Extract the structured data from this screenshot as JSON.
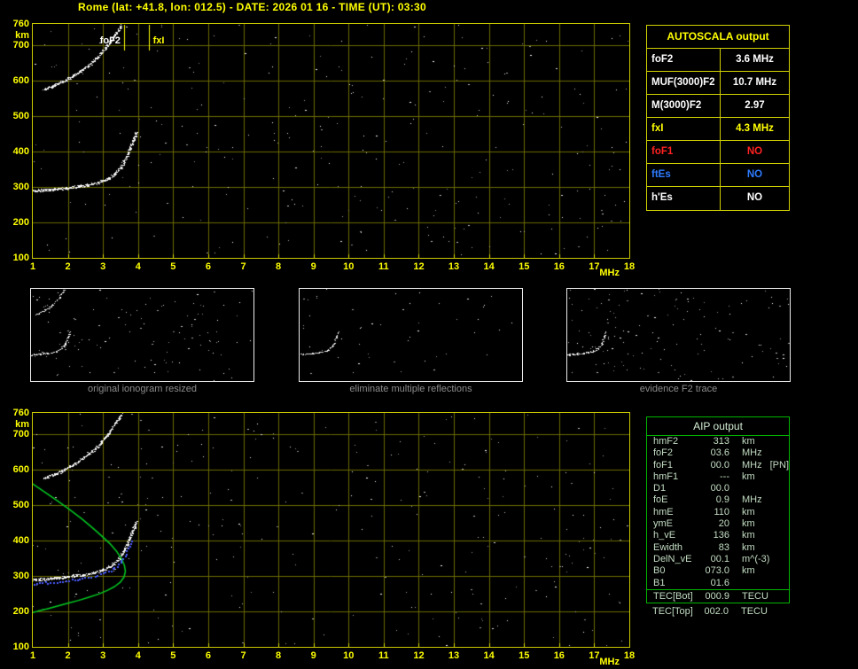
{
  "title": "Rome (lat: +41.8, lon: 012.5) - DATE: 2026 01 16 - TIME (UT): 03:30",
  "top_plot": {
    "y_unit": "km",
    "x_unit": "MHz",
    "y_ticks": [
      "760",
      "700",
      "600",
      "500",
      "400",
      "300",
      "200",
      "100"
    ],
    "x_ticks": [
      "1",
      "2",
      "3",
      "4",
      "5",
      "6",
      "7",
      "8",
      "9",
      "10",
      "11",
      "12",
      "13",
      "14",
      "15",
      "16",
      "17",
      "18"
    ],
    "markers": [
      {
        "label": "foF2",
        "freq_mhz": 3.6
      },
      {
        "label": "fxI",
        "freq_mhz": 4.3
      }
    ]
  },
  "bottom_plot": {
    "y_unit": "km",
    "x_unit": "MHz",
    "y_ticks": [
      "760",
      "700",
      "600",
      "500",
      "400",
      "300",
      "200",
      "100"
    ],
    "x_ticks": [
      "1",
      "2",
      "3",
      "4",
      "5",
      "6",
      "7",
      "8",
      "9",
      "10",
      "11",
      "12",
      "13",
      "14",
      "15",
      "16",
      "17",
      "18"
    ]
  },
  "autoscala_table": {
    "header": "AUTOSCALA output",
    "rows": [
      {
        "label": "foF2",
        "value": "3.6 MHz",
        "color": "white"
      },
      {
        "label": "MUF(3000)F2",
        "value": "10.7 MHz",
        "color": "white"
      },
      {
        "label": "M(3000)F2",
        "value": "2.97",
        "color": "white"
      },
      {
        "label": "fxI",
        "value": "4.3 MHz",
        "color": "yellow"
      },
      {
        "label": "foF1",
        "value": "NO",
        "color": "red"
      },
      {
        "label": "ftEs",
        "value": "NO",
        "color": "blue"
      },
      {
        "label": "h'Es",
        "value": "NO",
        "color": "white"
      }
    ]
  },
  "thumbnails": [
    {
      "caption": "original ionogram resized"
    },
    {
      "caption": "eliminate multiple reflections"
    },
    {
      "caption": "evidence F2 trace"
    }
  ],
  "aip_table": {
    "header": "AIP output",
    "rows": [
      {
        "label": "hmF2",
        "value": "313",
        "unit": "km"
      },
      {
        "label": "foF2",
        "value": "03.6",
        "unit": "MHz"
      },
      {
        "label": "foF1",
        "value": "00.0",
        "unit": "MHz",
        "extra": "[PN]"
      },
      {
        "label": "hmF1",
        "value": "---",
        "unit": "km"
      },
      {
        "label": "D1",
        "value": "00.0",
        "unit": ""
      },
      {
        "label": "foE",
        "value": "0.9",
        "unit": "MHz"
      },
      {
        "label": "hmE",
        "value": "110",
        "unit": "km"
      },
      {
        "label": "ymE",
        "value": "20",
        "unit": "km"
      },
      {
        "label": "h_vE",
        "value": "136",
        "unit": "km"
      },
      {
        "label": "Ewidth",
        "value": "83",
        "unit": "km"
      },
      {
        "label": "DelN_vE",
        "value": "00.1",
        "unit": "m^(-3)"
      },
      {
        "label": "B0",
        "value": "073.0",
        "unit": "km"
      },
      {
        "label": "B1",
        "value": "01.6",
        "unit": ""
      },
      {
        "label": "TEC[Bot]",
        "value": "000.9",
        "unit": "TECU",
        "section": "tecbot"
      },
      {
        "label": "TEC[Top]",
        "value": "002.0",
        "unit": "TECU",
        "section": "below"
      }
    ]
  },
  "colors": {
    "accent_yellow": "#ffff00",
    "plot_border_yellow": "#c9c900",
    "grid_olive": "#6b6b00",
    "table_border_yellow": "#d2d200",
    "aip_border_green": "#00b400",
    "profile_green": "#00cc22",
    "restored_blue": "#4a5cff",
    "status_red": "#ff2222",
    "status_blue": "#2e7bff",
    "caption_gray": "#8c8c8c"
  },
  "chart_data": {
    "type": "scatter",
    "title": "Ionogram: virtual height (km) vs frequency (MHz)",
    "xlabel": "MHz",
    "ylabel": "km",
    "xlim": [
      1,
      18
    ],
    "ylim": [
      100,
      760
    ],
    "grid": true,
    "traces": {
      "f2_trace": [
        [
          1.0,
          289
        ],
        [
          1.2,
          291
        ],
        [
          1.45,
          293
        ],
        [
          1.7,
          295
        ],
        [
          1.95,
          298
        ],
        [
          2.2,
          301
        ],
        [
          2.45,
          304
        ],
        [
          2.7,
          309
        ],
        [
          2.95,
          316
        ],
        [
          3.15,
          325
        ],
        [
          3.3,
          336
        ],
        [
          3.45,
          350
        ],
        [
          3.58,
          370
        ],
        [
          3.7,
          394
        ],
        [
          3.8,
          418
        ],
        [
          3.88,
          438
        ],
        [
          3.95,
          455
        ]
      ],
      "f2_second_hop": [
        [
          1.3,
          576
        ],
        [
          1.55,
          585
        ],
        [
          1.8,
          596
        ],
        [
          2.05,
          609
        ],
        [
          2.3,
          624
        ],
        [
          2.55,
          641
        ],
        [
          2.75,
          658
        ],
        [
          2.95,
          678
        ],
        [
          3.12,
          700
        ],
        [
          3.28,
          722
        ],
        [
          3.42,
          742
        ],
        [
          3.52,
          758
        ]
      ],
      "green_profile": [
        [
          1.0,
          560
        ],
        [
          1.35,
          536
        ],
        [
          1.7,
          512
        ],
        [
          2.05,
          487
        ],
        [
          2.4,
          461
        ],
        [
          2.7,
          436
        ],
        [
          2.95,
          414
        ],
        [
          3.2,
          391
        ],
        [
          3.4,
          368
        ],
        [
          3.53,
          348
        ],
        [
          3.61,
          330
        ],
        [
          3.64,
          313
        ],
        [
          3.6,
          297
        ],
        [
          3.5,
          283
        ],
        [
          3.33,
          270
        ],
        [
          3.12,
          259
        ],
        [
          2.88,
          249
        ],
        [
          2.6,
          240
        ],
        [
          2.3,
          231
        ],
        [
          2.0,
          223
        ],
        [
          1.7,
          215
        ],
        [
          1.4,
          207
        ],
        [
          1.15,
          201
        ],
        [
          1.0,
          197
        ]
      ],
      "blue_restored_trace": [
        [
          1.0,
          280
        ],
        [
          1.25,
          282
        ],
        [
          1.5,
          284
        ],
        [
          1.75,
          286
        ],
        [
          2.0,
          289
        ],
        [
          2.25,
          292
        ],
        [
          2.5,
          296
        ],
        [
          2.75,
          301
        ],
        [
          3.0,
          308
        ],
        [
          3.2,
          317
        ],
        [
          3.38,
          329
        ],
        [
          3.52,
          344
        ],
        [
          3.64,
          363
        ],
        [
          3.74,
          386
        ],
        [
          3.82,
          408
        ]
      ]
    }
  }
}
